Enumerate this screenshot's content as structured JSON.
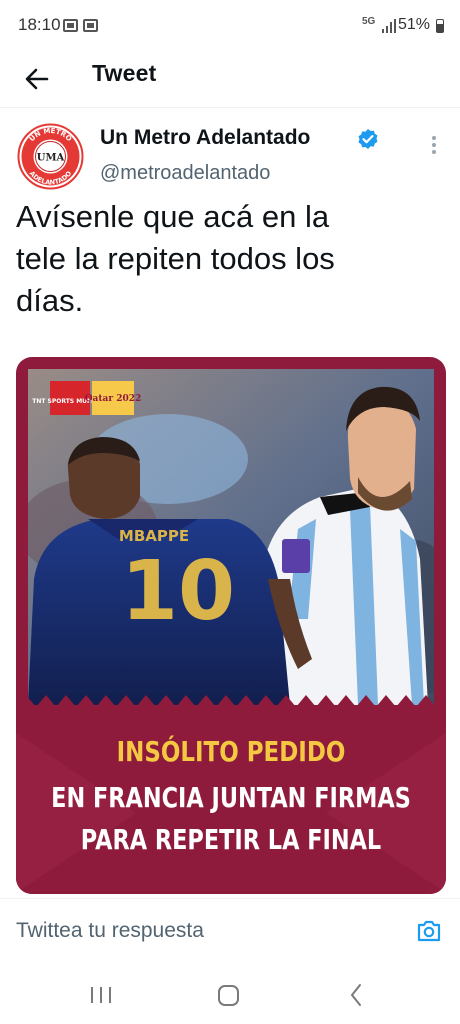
{
  "status_bar": {
    "time": "18:10",
    "network": "5G",
    "battery": "51%"
  },
  "header": {
    "title": "Tweet"
  },
  "tweet": {
    "author_name": "Un Metro Adelantado",
    "handle": "@metroadelantado",
    "text_lines": [
      "Avísenle que acá en la",
      "tele la repiten todos los",
      "días."
    ],
    "avatar": {
      "top_text": "UN METRO",
      "center_text": "UMA",
      "bottom_text": "ADELANTADO"
    },
    "media": {
      "broadcaster_logo": "TNT SPORTS MUNDIAL",
      "event_logo": "Qatar 2022",
      "jersey_name": "MBAPPE",
      "jersey_number": "10",
      "headline_1": "INSÓLITO PEDIDO",
      "headline_2": "EN FRANCIA JUNTAN FIRMAS",
      "headline_3": "PARA REPETIR LA FINAL"
    }
  },
  "reply": {
    "placeholder": "Twittea tu respuesta"
  },
  "colors": {
    "accent": "#1d9bf0",
    "banner": "#8f1b3c",
    "headline_gold": "#f5c842"
  },
  "icons": [
    "back-arrow-icon",
    "verified-badge-icon",
    "more-options-icon",
    "camera-icon",
    "recents-icon",
    "home-icon",
    "nav-back-icon"
  ]
}
